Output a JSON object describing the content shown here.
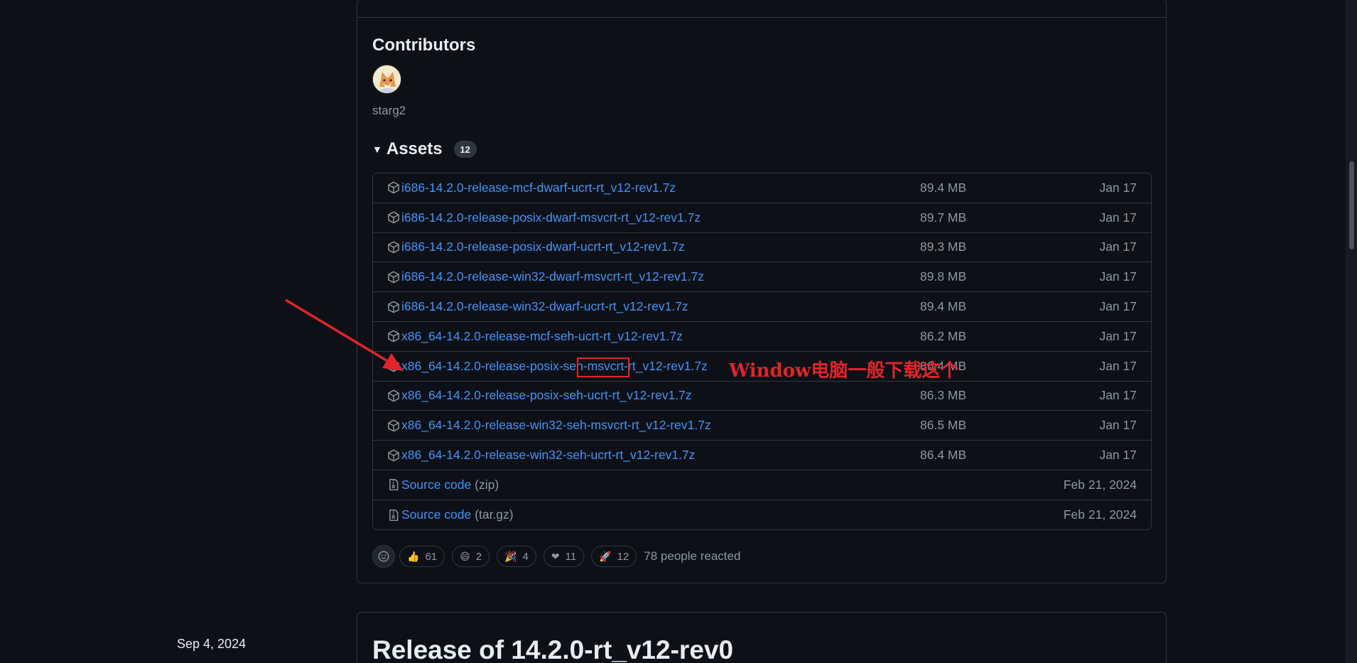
{
  "contributors": {
    "title": "Contributors",
    "users": [
      {
        "name": "starg2"
      }
    ]
  },
  "assets": {
    "title": "Assets",
    "count": "12",
    "items": [
      {
        "name": "i686-14.2.0-release-mcf-dwarf-ucrt-rt_v12-rev1.7z",
        "size": "89.4 MB",
        "date": "Jan 17",
        "icon": "package-icon"
      },
      {
        "name": "i686-14.2.0-release-posix-dwarf-msvcrt-rt_v12-rev1.7z",
        "size": "89.7 MB",
        "date": "Jan 17",
        "icon": "package-icon"
      },
      {
        "name": "i686-14.2.0-release-posix-dwarf-ucrt-rt_v12-rev1.7z",
        "size": "89.3 MB",
        "date": "Jan 17",
        "icon": "package-icon"
      },
      {
        "name": "i686-14.2.0-release-win32-dwarf-msvcrt-rt_v12-rev1.7z",
        "size": "89.8 MB",
        "date": "Jan 17",
        "icon": "package-icon"
      },
      {
        "name": "i686-14.2.0-release-win32-dwarf-ucrt-rt_v12-rev1.7z",
        "size": "89.4 MB",
        "date": "Jan 17",
        "icon": "package-icon"
      },
      {
        "name": "x86_64-14.2.0-release-mcf-seh-ucrt-rt_v12-rev1.7z",
        "size": "86.2 MB",
        "date": "Jan 17",
        "icon": "package-icon"
      },
      {
        "name": "x86_64-14.2.0-release-posix-seh-msvcrt-rt_v12-rev1.7z",
        "size": "86.4 MB",
        "date": "Jan 17",
        "icon": "package-icon"
      },
      {
        "name": "x86_64-14.2.0-release-posix-seh-ucrt-rt_v12-rev1.7z",
        "size": "86.3 MB",
        "date": "Jan 17",
        "icon": "package-icon"
      },
      {
        "name": "x86_64-14.2.0-release-win32-seh-msvcrt-rt_v12-rev1.7z",
        "size": "86.5 MB",
        "date": "Jan 17",
        "icon": "package-icon"
      },
      {
        "name": "x86_64-14.2.0-release-win32-seh-ucrt-rt_v12-rev1.7z",
        "size": "86.4 MB",
        "date": "Jan 17",
        "icon": "package-icon"
      },
      {
        "name": "Source code",
        "ext": "(zip)",
        "size": "",
        "date": "Feb 21, 2024",
        "icon": "file-zip-icon"
      },
      {
        "name": "Source code",
        "ext": "(tar.gz)",
        "size": "",
        "date": "Feb 21, 2024",
        "icon": "file-zip-icon"
      }
    ]
  },
  "reactions": {
    "items": [
      {
        "emoji": "👍",
        "count": "61",
        "icon": "thumbs-up-icon"
      },
      {
        "emoji": "😄",
        "count": "2",
        "icon": "laugh-icon"
      },
      {
        "emoji": "🎉",
        "count": "4",
        "icon": "hooray-icon"
      },
      {
        "emoji": "❤",
        "count": "11",
        "icon": "heart-icon"
      },
      {
        "emoji": "🚀",
        "count": "12",
        "icon": "rocket-icon"
      }
    ],
    "summary": "78 people reacted"
  },
  "next_release": {
    "date": "Sep 4, 2024",
    "title": "Release of 14.2.0-rt_v12-rev0"
  },
  "annotation": {
    "text": "Window电脑一般下载这个",
    "color": "#e0242a"
  },
  "colors": {
    "background": "#0d1117",
    "border": "#30363d",
    "link": "#4493f8",
    "muted": "#8d96a0"
  }
}
